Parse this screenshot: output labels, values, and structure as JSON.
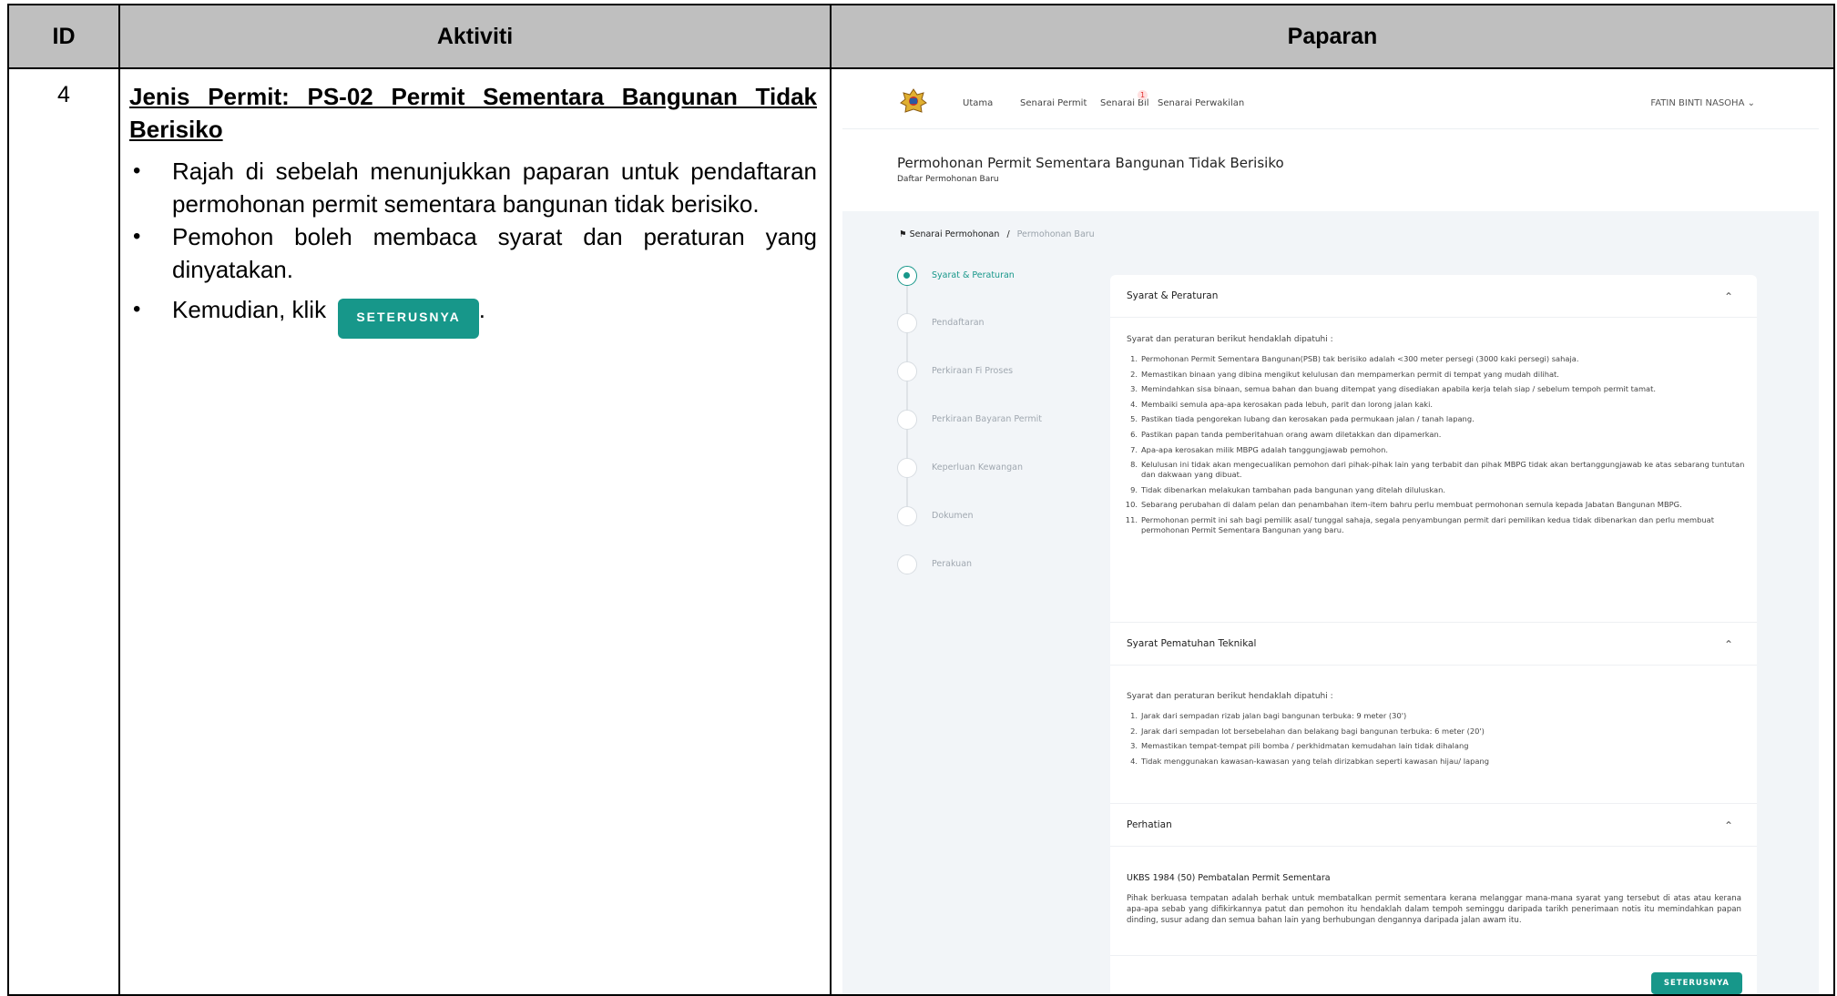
{
  "table": {
    "headers": {
      "id": "ID",
      "activity": "Aktiviti",
      "display": "Paparan"
    },
    "row": {
      "id": "4",
      "title_line1": "Jenis Permit: PS-02 Permit Sementara Bangunan Tidak",
      "title_line2": "Berisiko",
      "bullet1": "Rajah di sebelah menunjukkan paparan untuk pendaftaran permohonan permit sementara bangunan tidak berisiko.",
      "bullet2": "Pemohon boleh membaca syarat dan peraturan yang dinyatakan.",
      "bullet3_prefix": "Kemudian, klik",
      "bullet3_button": "SETERUSNYA",
      "bullet3_suffix": "."
    }
  },
  "app": {
    "nav": {
      "links": [
        "Utama",
        "Senarai Permit",
        "Senarai Bil",
        "Senarai Perwakilan"
      ],
      "badge": "1",
      "user": "FATIN BINTI NASOHA"
    },
    "header": {
      "title": "Permohonan Permit Sementara Bangunan Tidak Berisiko",
      "subtitle": "Daftar Permohonan Baru"
    },
    "breadcrumb": {
      "home": "Senarai Permohonan",
      "sep": "/",
      "current": "Permohonan Baru"
    },
    "steps": [
      "Syarat & Peraturan",
      "Pendaftaran",
      "Perkiraan Fi Proses",
      "Perkiraan Bayaran Permit",
      "Keperluan Kewangan",
      "Dokumen",
      "Perakuan"
    ],
    "sections": {
      "syarat": {
        "title": "Syarat & Peraturan",
        "intro": "Syarat dan peraturan berikut hendaklah dipatuhi :",
        "items": [
          "Permohonan Permit Sementara Bangunan(PSB) tak berisiko adalah <300 meter persegi (3000 kaki persegi) sahaja.",
          "Memastikan binaan yang dibina mengikut kelulusan dan mempamerkan permit di tempat yang mudah dilihat.",
          "Memindahkan sisa binaan, semua bahan dan buang ditempat yang disediakan apabila kerja telah siap / sebelum tempoh permit tamat.",
          "Membaiki semula apa-apa kerosakan pada lebuh, parit dan lorong jalan kaki.",
          "Pastikan tiada pengorekan lubang dan kerosakan pada permukaan jalan / tanah lapang.",
          "Pastikan papan tanda pemberitahuan orang awam diletakkan dan dipamerkan.",
          "Apa-apa kerosakan milik MBPG adalah tanggungjawab pemohon.",
          "Kelulusan ini tidak akan mengecualikan pemohon dari pihak-pihak lain yang terbabit dan pihak MBPG tidak akan bertanggungjawab ke atas sebarang tuntutan dan dakwaan yang dibuat.",
          "Tidak dibenarkan melakukan tambahan pada bangunan yang ditelah diluluskan.",
          "Sebarang perubahan di dalam pelan dan penambahan item-item bahru perlu membuat permohonan semula kepada Jabatan Bangunan MBPG.",
          "Permohonan permit ini sah bagi pemilik asal/ tunggal sahaja, segala penyambungan permit dari pemilikan kedua tidak dibenarkan dan perlu membuat permohonan Permit Sementara Bangunan yang baru."
        ]
      },
      "teknikal": {
        "title": "Syarat Pematuhan Teknikal",
        "intro": "Syarat dan peraturan berikut hendaklah dipatuhi :",
        "items": [
          "Jarak dari sempadan rizab jalan bagi bangunan terbuka: 9 meter (30')",
          "Jarak dari sempadan lot bersebelahan dan belakang bagi bangunan terbuka: 6 meter (20')",
          "Memastikan tempat-tempat pili bomba / perkhidmatan kemudahan lain tidak dihalang",
          "Tidak menggunakan kawasan-kawasan yang telah dirizabkan seperti kawasan hijau/ lapang"
        ]
      },
      "perhatian": {
        "title": "Perhatian",
        "subheading": "UKBS 1984 (50) Pembatalan Permit Sementara",
        "body": "Pihak berkuasa tempatan adalah berhak untuk membatalkan permit sementara kerana melanggar mana-mana syarat yang tersebut di atas atau kerana apa-apa sebab yang difikirkannya patut dan pemohon itu hendaklah dalam tempoh seminggu daripada tarikh penerimaan notis itu memindahkan papan dinding, susur adang dan semua bahan lain yang berhubungan dengannya daripada jalan awam itu."
      }
    },
    "next_button": "SETERUSNYA",
    "colors": {
      "accent": "#17978a",
      "header_bg": "#bfbfbf"
    }
  }
}
